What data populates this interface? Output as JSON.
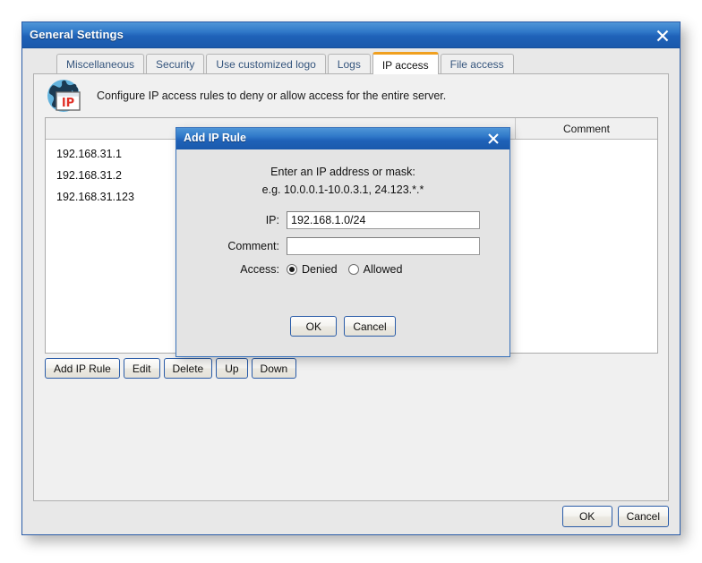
{
  "window": {
    "title": "General Settings",
    "close_icon": "close-x-icon"
  },
  "tabs": [
    {
      "label": "Miscellaneous",
      "active": false
    },
    {
      "label": "Security",
      "active": false
    },
    {
      "label": "Use customized logo",
      "active": false
    },
    {
      "label": "Logs",
      "active": false
    },
    {
      "label": "IP access",
      "active": true
    },
    {
      "label": "File access",
      "active": false
    }
  ],
  "content": {
    "icon": "globe-ip-icon",
    "description": "Configure IP access rules to deny or allow access for the entire server.",
    "table": {
      "columns": [
        "",
        "Comment"
      ],
      "rows": [
        {
          "ip": "192.168.31.1",
          "comment": ""
        },
        {
          "ip": "192.168.31.2",
          "comment": ""
        },
        {
          "ip": "192.168.31.123",
          "comment": ""
        }
      ]
    },
    "toolbar": [
      "Add IP Rule",
      "Edit",
      "Delete",
      "Up",
      "Down"
    ]
  },
  "footer": {
    "ok": "OK",
    "cancel": "Cancel"
  },
  "modal": {
    "title": "Add IP Rule",
    "close_icon": "close-x-icon",
    "hint_line1": "Enter an IP address or mask:",
    "hint_line2": "e.g. 10.0.0.1-10.0.3.1, 24.123.*.*",
    "ip_label": "IP:",
    "ip_value": "192.168.1.0/24",
    "ip_placeholder": "",
    "comment_label": "Comment:",
    "comment_value": "",
    "comment_placeholder": "",
    "access_label": "Access:",
    "access_options": [
      {
        "label": "Denied",
        "selected": true
      },
      {
        "label": "Allowed",
        "selected": false
      }
    ],
    "ok": "OK",
    "cancel": "Cancel"
  },
  "colors": {
    "titlebar_blue": "#1f62b8",
    "active_tab_accent": "#f0a020",
    "window_border": "#2a5ca8",
    "button_border": "#2a5ca8"
  }
}
